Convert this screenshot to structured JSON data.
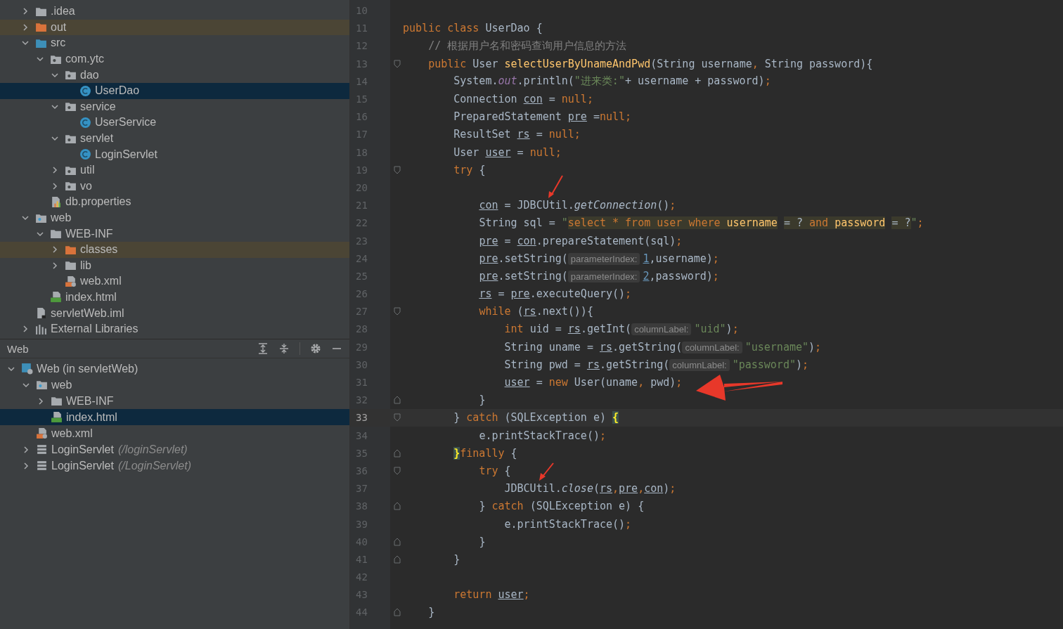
{
  "project_tree": [
    {
      "label": ".idea",
      "kind": "folder",
      "expanded": false,
      "selected": false,
      "excluded": false
    },
    {
      "label": "out",
      "kind": "folder",
      "expanded": false,
      "selected": false,
      "excluded": true
    },
    {
      "label": "src",
      "kind": "source-folder",
      "expanded": true,
      "selected": false,
      "excluded": false,
      "children": [
        {
          "label": "com.ytc",
          "kind": "package",
          "expanded": true,
          "selected": false,
          "excluded": false,
          "children": [
            {
              "label": "dao",
              "kind": "package",
              "expanded": true,
              "selected": false,
              "excluded": false,
              "children": [
                {
                  "label": "UserDao",
                  "kind": "class",
                  "selected": true
                }
              ]
            },
            {
              "label": "service",
              "kind": "package",
              "expanded": true,
              "selected": false,
              "excluded": false,
              "children": [
                {
                  "label": "UserService",
                  "kind": "class",
                  "selected": false
                }
              ]
            },
            {
              "label": "servlet",
              "kind": "package",
              "expanded": true,
              "selected": false,
              "excluded": false,
              "children": [
                {
                  "label": "LoginServlet",
                  "kind": "class",
                  "selected": false
                }
              ]
            },
            {
              "label": "util",
              "kind": "package",
              "expanded": false,
              "selected": false,
              "excluded": false
            },
            {
              "label": "vo",
              "kind": "package",
              "expanded": false,
              "selected": false,
              "excluded": false
            }
          ]
        },
        {
          "label": "db.properties",
          "kind": "properties",
          "selected": false
        }
      ]
    },
    {
      "label": "web",
      "kind": "web-folder",
      "expanded": true,
      "selected": false,
      "excluded": false,
      "children": [
        {
          "label": "WEB-INF",
          "kind": "folder",
          "expanded": true,
          "selected": false,
          "excluded": false,
          "children": [
            {
              "label": "classes",
              "kind": "folder",
              "expanded": false,
              "selected": false,
              "excluded": true
            },
            {
              "label": "lib",
              "kind": "folder",
              "expanded": false,
              "selected": false,
              "excluded": false
            },
            {
              "label": "web.xml",
              "kind": "xml",
              "selected": false
            }
          ]
        },
        {
          "label": "index.html",
          "kind": "html",
          "selected": false
        }
      ]
    },
    {
      "label": "servletWeb.iml",
      "kind": "iml",
      "selected": false
    },
    {
      "label": "External Libraries",
      "kind": "libraries",
      "expanded": false,
      "selected": false
    }
  ],
  "web_panel": {
    "title": "Web",
    "tree": [
      {
        "label": "Web (in servletWeb)",
        "kind": "web-facet",
        "expanded": true,
        "selected": false,
        "children": [
          {
            "label": "web",
            "kind": "web-folder",
            "expanded": true,
            "selected": false,
            "excluded": false,
            "children": [
              {
                "label": "WEB-INF",
                "kind": "folder",
                "expanded": false,
                "selected": false,
                "excluded": false
              },
              {
                "label": "index.html",
                "kind": "html",
                "selected": true
              }
            ]
          },
          {
            "label": "web.xml",
            "kind": "xml",
            "selected": false
          },
          {
            "label": "LoginServlet",
            "detail": "(/loginServlet)",
            "kind": "servlet",
            "expanded": false,
            "selected": false
          },
          {
            "label": "LoginServlet",
            "detail": "(/LoginServlet)",
            "kind": "servlet",
            "expanded": false,
            "selected": false
          }
        ]
      }
    ]
  },
  "editor": {
    "lines": [
      {
        "n": "10",
        "current": false
      },
      {
        "n": "11",
        "current": false,
        "tokens": [
          {
            "text": "public class ",
            "kind": "kw"
          },
          {
            "text": "UserDao {",
            "kind": "p"
          }
        ]
      },
      {
        "n": "12",
        "current": false,
        "tokens": [
          {
            "text": "    // 根据用户名和密码查询用户信息的方法",
            "kind": "cmt"
          }
        ]
      },
      {
        "n": "13",
        "current": false,
        "kind": "fold-start",
        "tokens": [
          {
            "text": "    public ",
            "kind": "kw"
          },
          {
            "text": "User ",
            "kind": "p"
          },
          {
            "text": "selectUserByUnameAndPwd",
            "kind": "fn"
          },
          {
            "text": "(String username",
            "kind": "p"
          },
          {
            "text": ", ",
            "kind": "kw"
          },
          {
            "text": "String password){",
            "kind": "p"
          }
        ]
      },
      {
        "n": "14",
        "current": false,
        "tokens": [
          {
            "text": "        System.",
            "kind": "p"
          },
          {
            "text": "out",
            "kind": "sf"
          },
          {
            "text": ".println(",
            "kind": "p"
          },
          {
            "text": "\"进来类:\"",
            "kind": "str"
          },
          {
            "text": "+ username + password)",
            "kind": "p"
          },
          {
            "text": ";",
            "kind": "kw"
          }
        ]
      },
      {
        "n": "15",
        "current": false,
        "tokens": [
          {
            "text": "        Connection ",
            "kind": "p"
          },
          {
            "text": "con",
            "kind": "u"
          },
          {
            "text": " = ",
            "kind": "p"
          },
          {
            "text": "null;",
            "kind": "kw"
          }
        ]
      },
      {
        "n": "16",
        "current": false,
        "tokens": [
          {
            "text": "        PreparedStatement ",
            "kind": "p"
          },
          {
            "text": "pre",
            "kind": "u"
          },
          {
            "text": " =",
            "kind": "p"
          },
          {
            "text": "null;",
            "kind": "kw"
          }
        ]
      },
      {
        "n": "17",
        "current": false,
        "tokens": [
          {
            "text": "        ResultSet ",
            "kind": "p"
          },
          {
            "text": "rs",
            "kind": "u"
          },
          {
            "text": " = ",
            "kind": "p"
          },
          {
            "text": "null;",
            "kind": "kw"
          }
        ]
      },
      {
        "n": "18",
        "current": false,
        "tokens": [
          {
            "text": "        User ",
            "kind": "p"
          },
          {
            "text": "user",
            "kind": "u"
          },
          {
            "text": " = ",
            "kind": "p"
          },
          {
            "text": "null;",
            "kind": "kw"
          }
        ]
      },
      {
        "n": "19",
        "current": false,
        "kind": "fold-start",
        "tokens": [
          {
            "text": "        try ",
            "kind": "kw"
          },
          {
            "text": "{",
            "kind": "p"
          }
        ]
      },
      {
        "n": "20",
        "current": false
      },
      {
        "n": "21",
        "current": false,
        "tokens": [
          {
            "text": "            con",
            "kind": "u"
          },
          {
            "text": " = JDBCUtil.",
            "kind": "p"
          },
          {
            "text": "getConnection",
            "kind": "it"
          },
          {
            "text": "()",
            "kind": "p"
          },
          {
            "text": ";",
            "kind": "kw"
          }
        ]
      },
      {
        "n": "22",
        "current": false,
        "tokens": [
          {
            "text": "            String sql = ",
            "kind": "p"
          },
          {
            "text": "\"",
            "kind": "str"
          },
          {
            "text": "select * from user where ",
            "kind": "sqlkw"
          },
          {
            "text": "username",
            "kind": "sqlid"
          },
          {
            "text": " = ? ",
            "kind": "sqlp"
          },
          {
            "text": "and ",
            "kind": "sqlkw"
          },
          {
            "text": "password",
            "kind": "sqlid"
          },
          {
            "text": " = ?",
            "kind": "sqlp"
          },
          {
            "text": "\"",
            "kind": "str"
          },
          {
            "text": ";",
            "kind": "kw"
          }
        ]
      },
      {
        "n": "23",
        "current": false,
        "tokens": [
          {
            "text": "            pre",
            "kind": "u"
          },
          {
            "text": " = ",
            "kind": "p"
          },
          {
            "text": "con",
            "kind": "u"
          },
          {
            "text": ".prepareStatement(sql)",
            "kind": "p"
          },
          {
            "text": ";",
            "kind": "kw"
          }
        ]
      },
      {
        "n": "24",
        "current": false,
        "tokens": [
          {
            "text": "            pre",
            "kind": "u"
          },
          {
            "text": ".setString(",
            "kind": "p"
          },
          {
            "text": "parameterIndex:",
            "kind": "hint"
          },
          {
            "text": "1",
            "kind": "num"
          },
          {
            "text": ",username)",
            "kind": "p"
          },
          {
            "text": ";",
            "kind": "kw"
          }
        ]
      },
      {
        "n": "25",
        "current": false,
        "tokens": [
          {
            "text": "            pre",
            "kind": "u"
          },
          {
            "text": ".setString(",
            "kind": "p"
          },
          {
            "text": "parameterIndex:",
            "kind": "hint"
          },
          {
            "text": "2",
            "kind": "num"
          },
          {
            "text": ",password)",
            "kind": "p"
          },
          {
            "text": ";",
            "kind": "kw"
          }
        ]
      },
      {
        "n": "26",
        "current": false,
        "tokens": [
          {
            "text": "            rs",
            "kind": "u"
          },
          {
            "text": " = ",
            "kind": "p"
          },
          {
            "text": "pre",
            "kind": "u"
          },
          {
            "text": ".executeQuery()",
            "kind": "p"
          },
          {
            "text": ";",
            "kind": "kw"
          }
        ]
      },
      {
        "n": "27",
        "current": false,
        "kind": "fold-start",
        "tokens": [
          {
            "text": "            while ",
            "kind": "kw"
          },
          {
            "text": "(",
            "kind": "p"
          },
          {
            "text": "rs",
            "kind": "u"
          },
          {
            "text": ".next()){",
            "kind": "p"
          }
        ]
      },
      {
        "n": "28",
        "current": false,
        "tokens": [
          {
            "text": "                int ",
            "kind": "kw"
          },
          {
            "text": "uid = ",
            "kind": "p"
          },
          {
            "text": "rs",
            "kind": "u"
          },
          {
            "text": ".getInt(",
            "kind": "p"
          },
          {
            "text": "columnLabel:",
            "kind": "hint"
          },
          {
            "text": "\"uid\"",
            "kind": "str"
          },
          {
            "text": ")",
            "kind": "p"
          },
          {
            "text": ";",
            "kind": "kw"
          }
        ]
      },
      {
        "n": "29",
        "current": false,
        "tokens": [
          {
            "text": "                String uname = ",
            "kind": "p"
          },
          {
            "text": "rs",
            "kind": "u"
          },
          {
            "text": ".getString(",
            "kind": "p"
          },
          {
            "text": "columnLabel:",
            "kind": "hint"
          },
          {
            "text": "\"username\"",
            "kind": "str"
          },
          {
            "text": ")",
            "kind": "p"
          },
          {
            "text": ";",
            "kind": "kw"
          }
        ]
      },
      {
        "n": "30",
        "current": false,
        "tokens": [
          {
            "text": "                String pwd = ",
            "kind": "p"
          },
          {
            "text": "rs",
            "kind": "u"
          },
          {
            "text": ".getString(",
            "kind": "p"
          },
          {
            "text": "columnLabel:",
            "kind": "hint"
          },
          {
            "text": "\"password\"",
            "kind": "str"
          },
          {
            "text": ")",
            "kind": "p"
          },
          {
            "text": ";",
            "kind": "kw"
          }
        ]
      },
      {
        "n": "31",
        "current": false,
        "tokens": [
          {
            "text": "                user",
            "kind": "u"
          },
          {
            "text": " = ",
            "kind": "p"
          },
          {
            "text": "new ",
            "kind": "kw"
          },
          {
            "text": "User(uname",
            "kind": "p"
          },
          {
            "text": ", ",
            "kind": "kw"
          },
          {
            "text": "pwd)",
            "kind": "p"
          },
          {
            "text": ";",
            "kind": "kw"
          }
        ]
      },
      {
        "n": "32",
        "current": false,
        "kind": "fold-end",
        "tokens": [
          {
            "text": "            }",
            "kind": "p"
          }
        ]
      },
      {
        "n": "33",
        "current": true,
        "kind": "fold-start",
        "tokens": [
          {
            "text": "        } ",
            "kind": "p"
          },
          {
            "text": "catch ",
            "kind": "kw"
          },
          {
            "text": "(SQLException e) ",
            "kind": "p"
          },
          {
            "text": "{",
            "kind": "br"
          }
        ]
      },
      {
        "n": "34",
        "current": false,
        "tokens": [
          {
            "text": "            e.printStackTrace()",
            "kind": "p"
          },
          {
            "text": ";",
            "kind": "kw"
          }
        ]
      },
      {
        "n": "35",
        "current": false,
        "kind": "fold-end",
        "tokens": [
          {
            "text": "        }",
            "kind": "br"
          },
          {
            "text": "finally ",
            "kind": "kw"
          },
          {
            "text": "{",
            "kind": "p"
          }
        ]
      },
      {
        "n": "36",
        "current": false,
        "kind": "fold-start",
        "tokens": [
          {
            "text": "            try ",
            "kind": "kw"
          },
          {
            "text": "{",
            "kind": "p"
          }
        ]
      },
      {
        "n": "37",
        "current": false,
        "tokens": [
          {
            "text": "                JDBCUtil.",
            "kind": "p"
          },
          {
            "text": "close",
            "kind": "it"
          },
          {
            "text": "(",
            "kind": "p"
          },
          {
            "text": "rs",
            "kind": "u"
          },
          {
            "text": ",",
            "kind": "kw"
          },
          {
            "text": "pre",
            "kind": "u"
          },
          {
            "text": ",",
            "kind": "kw"
          },
          {
            "text": "con",
            "kind": "u"
          },
          {
            "text": ")",
            "kind": "p"
          },
          {
            "text": ";",
            "kind": "kw"
          }
        ]
      },
      {
        "n": "38",
        "current": false,
        "kind": "fold-end",
        "tokens": [
          {
            "text": "            } ",
            "kind": "p"
          },
          {
            "text": "catch ",
            "kind": "kw"
          },
          {
            "text": "(SQLException e) {",
            "kind": "p"
          }
        ]
      },
      {
        "n": "39",
        "current": false,
        "tokens": [
          {
            "text": "                e.printStackTrace()",
            "kind": "p"
          },
          {
            "text": ";",
            "kind": "kw"
          }
        ]
      },
      {
        "n": "40",
        "current": false,
        "kind": "fold-end",
        "tokens": [
          {
            "text": "            }",
            "kind": "p"
          }
        ]
      },
      {
        "n": "41",
        "current": false,
        "kind": "fold-end",
        "tokens": [
          {
            "text": "        }",
            "kind": "p"
          }
        ]
      },
      {
        "n": "42",
        "current": false
      },
      {
        "n": "43",
        "current": false,
        "tokens": [
          {
            "text": "        return ",
            "kind": "kw"
          },
          {
            "text": "user",
            "kind": "u"
          },
          {
            "text": ";",
            "kind": "kw"
          }
        ]
      },
      {
        "n": "44",
        "current": false,
        "kind": "fold-end",
        "tokens": [
          {
            "text": "    }",
            "kind": "p"
          }
        ]
      }
    ]
  }
}
